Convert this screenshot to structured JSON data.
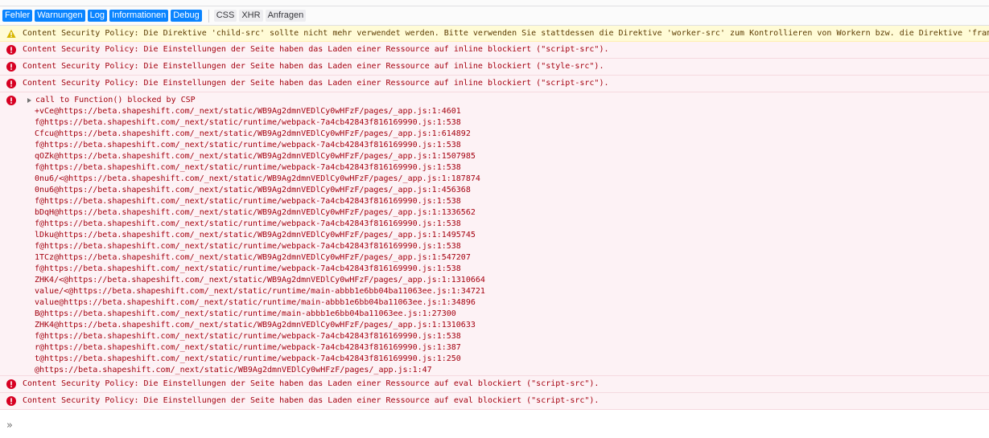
{
  "toolbar": {
    "filters": [
      {
        "label": "Fehler",
        "active": true
      },
      {
        "label": "Warnungen",
        "active": true
      },
      {
        "label": "Log",
        "active": true
      },
      {
        "label": "Informationen",
        "active": true
      },
      {
        "label": "Debug",
        "active": true
      }
    ],
    "type_filters": [
      {
        "label": "CSS",
        "active": false
      },
      {
        "label": "XHR",
        "active": false
      },
      {
        "label": "Anfragen",
        "active": false
      }
    ]
  },
  "messages": [
    {
      "level": "warning",
      "icon": "warning-icon",
      "text": "Content Security Policy: Die Direktive 'child-src' sollte nicht mehr verwendet werden. Bitte verwenden Sie stattdessen die Direktive 'worker-src' zum Kontrollieren von Workern bzw. die Direktive 'fram"
    },
    {
      "level": "error",
      "icon": "error-icon",
      "text": "Content Security Policy: Die Einstellungen der Seite haben das Laden einer Ressource auf inline blockiert (\"script-src\")."
    },
    {
      "level": "error",
      "icon": "error-icon",
      "text": "Content Security Policy: Die Einstellungen der Seite haben das Laden einer Ressource auf inline blockiert (\"style-src\")."
    },
    {
      "level": "error",
      "icon": "error-icon",
      "text": "Content Security Policy: Die Einstellungen der Seite haben das Laden einer Ressource auf inline blockiert (\"script-src\")."
    }
  ],
  "stack_message": {
    "level": "error",
    "icon": "error-icon",
    "title": "call to Function() blocked by CSP",
    "frames": [
      "+vCe@https://beta.shapeshift.com/_next/static/WB9Ag2dmnVEDlCy0wHFzF/pages/_app.js:1:4601",
      "f@https://beta.shapeshift.com/_next/static/runtime/webpack-7a4cb42843f816169990.js:1:538",
      "Cfcu@https://beta.shapeshift.com/_next/static/WB9Ag2dmnVEDlCy0wHFzF/pages/_app.js:1:614892",
      "f@https://beta.shapeshift.com/_next/static/runtime/webpack-7a4cb42843f816169990.js:1:538",
      "qOZk@https://beta.shapeshift.com/_next/static/WB9Ag2dmnVEDlCy0wHFzF/pages/_app.js:1:1507985",
      "f@https://beta.shapeshift.com/_next/static/runtime/webpack-7a4cb42843f816169990.js:1:538",
      "0nu6/<@https://beta.shapeshift.com/_next/static/WB9Ag2dmnVEDlCy0wHFzF/pages/_app.js:1:187874",
      "0nu6@https://beta.shapeshift.com/_next/static/WB9Ag2dmnVEDlCy0wHFzF/pages/_app.js:1:456368",
      "f@https://beta.shapeshift.com/_next/static/runtime/webpack-7a4cb42843f816169990.js:1:538",
      "bDqH@https://beta.shapeshift.com/_next/static/WB9Ag2dmnVEDlCy0wHFzF/pages/_app.js:1:1336562",
      "f@https://beta.shapeshift.com/_next/static/runtime/webpack-7a4cb42843f816169990.js:1:538",
      "lDku@https://beta.shapeshift.com/_next/static/WB9Ag2dmnVEDlCy0wHFzF/pages/_app.js:1:1495745",
      "f@https://beta.shapeshift.com/_next/static/runtime/webpack-7a4cb42843f816169990.js:1:538",
      "1TCz@https://beta.shapeshift.com/_next/static/WB9Ag2dmnVEDlCy0wHFzF/pages/_app.js:1:547207",
      "f@https://beta.shapeshift.com/_next/static/runtime/webpack-7a4cb42843f816169990.js:1:538",
      "ZHK4/<@https://beta.shapeshift.com/_next/static/WB9Ag2dmnVEDlCy0wHFzF/pages/_app.js:1:1310664",
      "value/<@https://beta.shapeshift.com/_next/static/runtime/main-abbb1e6bb04ba11063ee.js:1:34721",
      "value@https://beta.shapeshift.com/_next/static/runtime/main-abbb1e6bb04ba11063ee.js:1:34896",
      "B@https://beta.shapeshift.com/_next/static/runtime/main-abbb1e6bb04ba11063ee.js:1:27300",
      "ZHK4@https://beta.shapeshift.com/_next/static/WB9Ag2dmnVEDlCy0wHFzF/pages/_app.js:1:1310633",
      "f@https://beta.shapeshift.com/_next/static/runtime/webpack-7a4cb42843f816169990.js:1:538",
      "r@https://beta.shapeshift.com/_next/static/runtime/webpack-7a4cb42843f816169990.js:1:387",
      "t@https://beta.shapeshift.com/_next/static/runtime/webpack-7a4cb42843f816169990.js:1:250",
      "@https://beta.shapeshift.com/_next/static/WB9Ag2dmnVEDlCy0wHFzF/pages/_app.js:1:47"
    ]
  },
  "trailing_messages": [
    {
      "level": "error",
      "icon": "error-icon",
      "text": "Content Security Policy: Die Einstellungen der Seite haben das Laden einer Ressource auf eval blockiert (\"script-src\")."
    },
    {
      "level": "error",
      "icon": "error-icon",
      "text": "Content Security Policy: Die Einstellungen der Seite haben das Laden einer Ressource auf eval blockiert (\"script-src\")."
    }
  ],
  "input": {
    "prompt_icon": "chevron-double-right-icon",
    "prompt": "»",
    "placeholder": ""
  },
  "colors": {
    "accent": "#0a84ff",
    "error_bg": "#fdf2f5",
    "error_text": "#a4000f",
    "warning_bg": "#fffbd6",
    "warning_text": "#5c3b00"
  }
}
